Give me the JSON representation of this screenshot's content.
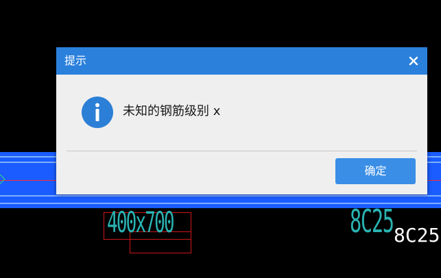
{
  "dialog": {
    "title": "提示",
    "message": "未知的钢筋级别 x",
    "ok_label": "确定",
    "close_glyph": "×"
  },
  "cad": {
    "section_label": "400x700",
    "rebar_label_cyan": "8C25",
    "rebar_label_white": "8C25"
  },
  "icons": {
    "close": "close-icon",
    "info": "info-icon"
  },
  "colors": {
    "titlebar": "#2b80dc",
    "button": "#3a8ee6",
    "info_icon": "#2b7fd6",
    "beam": "#1a5cff",
    "cad_text": "#2ab3b3",
    "dimension_box": "#d01818"
  }
}
